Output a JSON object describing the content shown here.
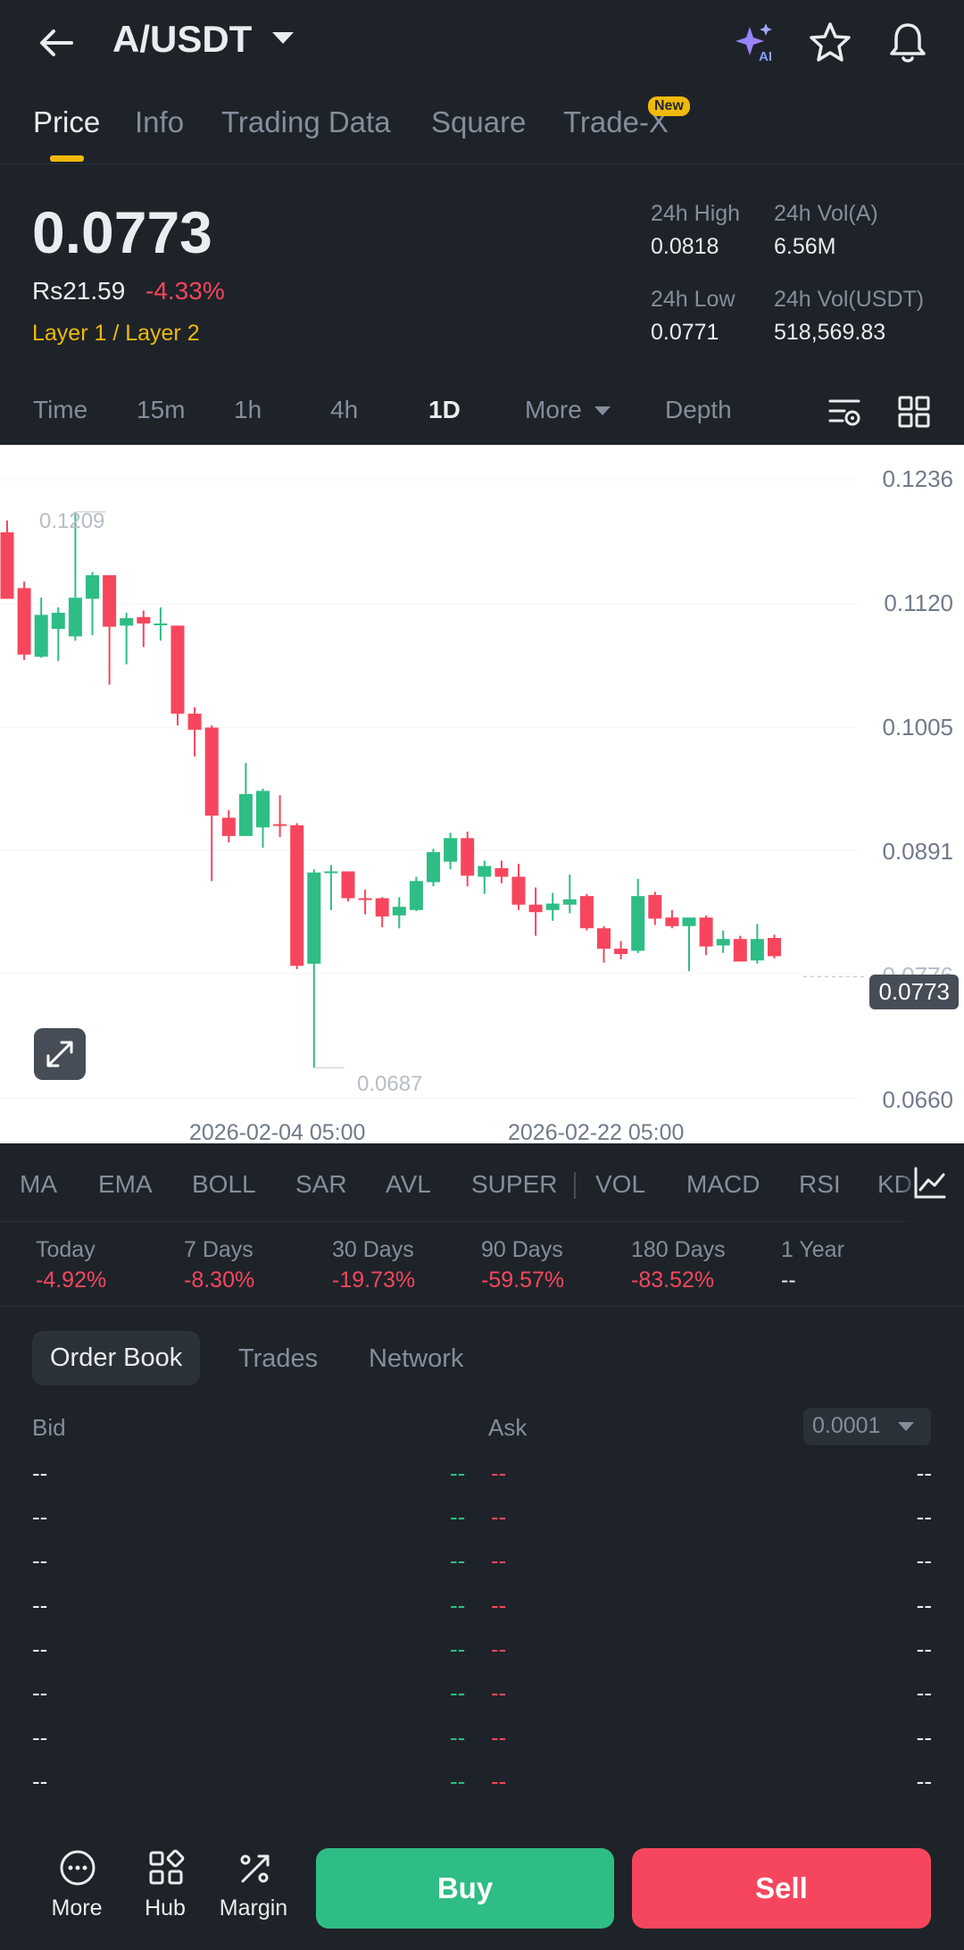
{
  "header": {
    "pair": "A/USDT",
    "back_icon": "arrow-left-icon",
    "ai_icon": "sparkle-ai-icon",
    "ai_badge": "AI",
    "favorite_icon": "star-icon",
    "alert_icon": "bell-icon"
  },
  "tabs": [
    {
      "label": "Price",
      "active": true
    },
    {
      "label": "Info"
    },
    {
      "label": "Trading Data"
    },
    {
      "label": "Square"
    },
    {
      "label": "Trade-X",
      "badge": "New"
    }
  ],
  "price": {
    "last": "0.0773",
    "fiat": "Rs21.59",
    "change": "-4.33%",
    "tag": "Layer 1 / Layer 2"
  },
  "stats": {
    "high_label": "24h High",
    "high_value": "0.0818",
    "vol_base_label": "24h Vol(A)",
    "vol_base_value": "6.56M",
    "low_label": "24h Low",
    "low_value": "0.0771",
    "vol_quote_label": "24h Vol(USDT)",
    "vol_quote_value": "518,569.83"
  },
  "intervals": [
    "Time",
    "15m",
    "1h",
    "4h",
    "1D",
    "More",
    "Depth"
  ],
  "active_interval": "1D",
  "chart_data": {
    "type": "candlestick",
    "y_ticks": [
      "0.1236",
      "0.1120",
      "0.1005",
      "0.0891",
      "0.0776",
      "0.0660"
    ],
    "ylim": [
      0.066,
      0.1236
    ],
    "x_ticks": [
      "2026-02-04 05:00",
      "2026-02-22 05:00"
    ],
    "high_marker": "0.1209",
    "low_marker": "0.0687",
    "current_price": "0.0773",
    "up_color": "#2ebd85",
    "down_color": "#f6465d",
    "candles": [
      {
        "o": 0.1187,
        "h": 0.1198,
        "l": 0.1125,
        "c": 0.1125
      },
      {
        "o": 0.1135,
        "h": 0.1141,
        "l": 0.1068,
        "c": 0.1073
      },
      {
        "o": 0.1071,
        "h": 0.1126,
        "l": 0.107,
        "c": 0.111
      },
      {
        "o": 0.1097,
        "h": 0.1117,
        "l": 0.1067,
        "c": 0.1112
      },
      {
        "o": 0.109,
        "h": 0.1206,
        "l": 0.1086,
        "c": 0.1126
      },
      {
        "o": 0.1125,
        "h": 0.115,
        "l": 0.1091,
        "c": 0.1147
      },
      {
        "o": 0.1147,
        "h": 0.1147,
        "l": 0.1045,
        "c": 0.1099
      },
      {
        "o": 0.11,
        "h": 0.1112,
        "l": 0.1064,
        "c": 0.1107
      },
      {
        "o": 0.1108,
        "h": 0.1114,
        "l": 0.108,
        "c": 0.1102
      },
      {
        "o": 0.1102,
        "h": 0.1117,
        "l": 0.1086,
        "c": 0.1102
      },
      {
        "o": 0.11,
        "h": 0.11,
        "l": 0.1007,
        "c": 0.1018
      },
      {
        "o": 0.1018,
        "h": 0.1024,
        "l": 0.0978,
        "c": 0.1003
      },
      {
        "o": 0.1005,
        "h": 0.1007,
        "l": 0.0862,
        "c": 0.0923
      },
      {
        "o": 0.0921,
        "h": 0.0928,
        "l": 0.0898,
        "c": 0.0904
      },
      {
        "o": 0.0904,
        "h": 0.0972,
        "l": 0.0904,
        "c": 0.0943
      },
      {
        "o": 0.0912,
        "h": 0.0948,
        "l": 0.0893,
        "c": 0.0946
      },
      {
        "o": 0.0915,
        "h": 0.0942,
        "l": 0.0903,
        "c": 0.0914
      },
      {
        "o": 0.0914,
        "h": 0.0916,
        "l": 0.078,
        "c": 0.0783
      },
      {
        "o": 0.0785,
        "h": 0.0873,
        "l": 0.0688,
        "c": 0.087
      },
      {
        "o": 0.087,
        "h": 0.0877,
        "l": 0.0835,
        "c": 0.0871
      },
      {
        "o": 0.0871,
        "h": 0.0871,
        "l": 0.0843,
        "c": 0.0846
      },
      {
        "o": 0.0846,
        "h": 0.0854,
        "l": 0.0831,
        "c": 0.0845
      },
      {
        "o": 0.0846,
        "h": 0.0847,
        "l": 0.0819,
        "c": 0.0829
      },
      {
        "o": 0.083,
        "h": 0.0847,
        "l": 0.0818,
        "c": 0.0838
      },
      {
        "o": 0.0835,
        "h": 0.0866,
        "l": 0.0834,
        "c": 0.0862
      },
      {
        "o": 0.0861,
        "h": 0.0892,
        "l": 0.0857,
        "c": 0.0889
      },
      {
        "o": 0.088,
        "h": 0.0907,
        "l": 0.0873,
        "c": 0.0902
      },
      {
        "o": 0.0902,
        "h": 0.0908,
        "l": 0.0857,
        "c": 0.0867
      },
      {
        "o": 0.0866,
        "h": 0.0881,
        "l": 0.085,
        "c": 0.0876
      },
      {
        "o": 0.0874,
        "h": 0.0881,
        "l": 0.086,
        "c": 0.0866
      },
      {
        "o": 0.0866,
        "h": 0.0878,
        "l": 0.0835,
        "c": 0.084
      },
      {
        "o": 0.084,
        "h": 0.0856,
        "l": 0.0811,
        "c": 0.0833
      },
      {
        "o": 0.0835,
        "h": 0.0851,
        "l": 0.0825,
        "c": 0.0841
      },
      {
        "o": 0.084,
        "h": 0.0868,
        "l": 0.0832,
        "c": 0.0845
      },
      {
        "o": 0.0848,
        "h": 0.085,
        "l": 0.0816,
        "c": 0.0818
      },
      {
        "o": 0.0818,
        "h": 0.082,
        "l": 0.0786,
        "c": 0.0799
      },
      {
        "o": 0.0799,
        "h": 0.0806,
        "l": 0.0789,
        "c": 0.0794
      },
      {
        "o": 0.0797,
        "h": 0.0864,
        "l": 0.0795,
        "c": 0.0848
      },
      {
        "o": 0.0849,
        "h": 0.0852,
        "l": 0.0821,
        "c": 0.0827
      },
      {
        "o": 0.0828,
        "h": 0.0835,
        "l": 0.0818,
        "c": 0.082
      },
      {
        "o": 0.082,
        "h": 0.0826,
        "l": 0.0778,
        "c": 0.0828
      },
      {
        "o": 0.0828,
        "h": 0.083,
        "l": 0.0793,
        "c": 0.0801
      },
      {
        "o": 0.0802,
        "h": 0.0816,
        "l": 0.0795,
        "c": 0.0808
      },
      {
        "o": 0.0808,
        "h": 0.0811,
        "l": 0.0788,
        "c": 0.0787
      },
      {
        "o": 0.0788,
        "h": 0.0822,
        "l": 0.0785,
        "c": 0.0808
      },
      {
        "o": 0.0809,
        "h": 0.0812,
        "l": 0.079,
        "c": 0.0792
      }
    ]
  },
  "indicators": [
    "MA",
    "EMA",
    "BOLL",
    "SAR",
    "AVL",
    "SUPER",
    "VOL",
    "MACD",
    "RSI",
    "KD"
  ],
  "indicator_settings_icon": "chart-settings-icon",
  "periods": [
    {
      "label": "Today",
      "value": "-4.92%"
    },
    {
      "label": "7 Days",
      "value": "-8.30%"
    },
    {
      "label": "30 Days",
      "value": "-19.73%"
    },
    {
      "label": "90 Days",
      "value": "-59.57%"
    },
    {
      "label": "180 Days",
      "value": "-83.52%"
    },
    {
      "label": "1 Year",
      "value": "--"
    }
  ],
  "orderbook": {
    "tabs": [
      "Order Book",
      "Trades",
      "Network"
    ],
    "bid_label": "Bid",
    "ask_label": "Ask",
    "tick_size": "0.0001",
    "rows": [
      {
        "bid": "--",
        "bid_sz": "--",
        "ask_sz": "--",
        "ask": "--"
      },
      {
        "bid": "--",
        "bid_sz": "--",
        "ask_sz": "--",
        "ask": "--"
      },
      {
        "bid": "--",
        "bid_sz": "--",
        "ask_sz": "--",
        "ask": "--"
      },
      {
        "bid": "--",
        "bid_sz": "--",
        "ask_sz": "--",
        "ask": "--"
      },
      {
        "bid": "--",
        "bid_sz": "--",
        "ask_sz": "--",
        "ask": "--"
      },
      {
        "bid": "--",
        "bid_sz": "--",
        "ask_sz": "--",
        "ask": "--"
      },
      {
        "bid": "--",
        "bid_sz": "--",
        "ask_sz": "--",
        "ask": "--"
      },
      {
        "bid": "--",
        "bid_sz": "--",
        "ask_sz": "--",
        "ask": "--"
      }
    ]
  },
  "bottom_bar": {
    "more": "More",
    "hub": "Hub",
    "margin": "Margin",
    "buy": "Buy",
    "sell": "Sell"
  },
  "colors": {
    "background": "#1e2329",
    "accent": "#f0b90b",
    "up": "#2ebd85",
    "down": "#f6465d"
  }
}
